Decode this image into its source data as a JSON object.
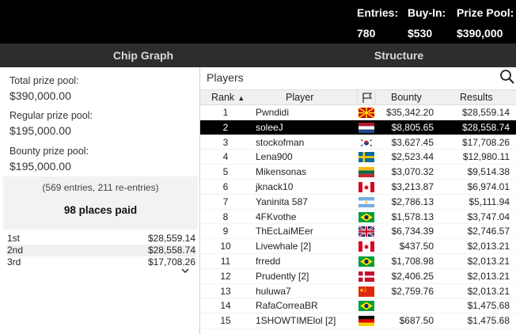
{
  "header": {
    "entries_label": "Entries:",
    "entries_value": "780",
    "buyin_label": "Buy-In:",
    "buyin_value": "$530",
    "prize_label": "Prize Pool:",
    "prize_value": "$390,000"
  },
  "tabs": {
    "chip_graph": "Chip Graph",
    "structure": "Structure"
  },
  "left_panel": {
    "total_label": "Total prize pool:",
    "total_value": "$390,000.00",
    "regular_label": "Regular prize pool:",
    "regular_value": "$195,000.00",
    "bounty_label": "Bounty prize pool:",
    "bounty_value": "$195,000.00",
    "entries_note": "(569 entries, 211 re-entries)",
    "places_paid": "98 places paid",
    "payouts": [
      {
        "place": "1st",
        "amount": "$28,559.14"
      },
      {
        "place": "2nd",
        "amount": "$28,558.74"
      },
      {
        "place": "3rd",
        "amount": "$17,708.26"
      }
    ]
  },
  "players_panel": {
    "title": "Players",
    "columns": {
      "rank": "Rank",
      "player": "Player",
      "bounty": "Bounty",
      "results": "Results"
    },
    "rows": [
      {
        "rank": "1",
        "player": "Pwndidi",
        "flag": "north-macedonia-flag",
        "bounty": "$35,342.20",
        "result": "$28,559.14"
      },
      {
        "rank": "2",
        "player": "soleeJ",
        "flag": "netherlands-flag",
        "bounty": "$8,805.65",
        "result": "$28,558.74"
      },
      {
        "rank": "3",
        "player": "stockofman",
        "flag": "south-korea-flag",
        "bounty": "$3,627.45",
        "result": "$17,708.26"
      },
      {
        "rank": "4",
        "player": "Lena900",
        "flag": "sweden-flag",
        "bounty": "$2,523.44",
        "result": "$12,980.11"
      },
      {
        "rank": "5",
        "player": "Mikensonas",
        "flag": "lithuania-flag",
        "bounty": "$3,070.32",
        "result": "$9,514.38"
      },
      {
        "rank": "6",
        "player": "jknack10",
        "flag": "canada-flag",
        "bounty": "$3,213.87",
        "result": "$6,974.01"
      },
      {
        "rank": "7",
        "player": "Yaninita 587",
        "flag": "argentina-flag",
        "bounty": "$2,786.13",
        "result": "$5,111.94"
      },
      {
        "rank": "8",
        "player": "4FKvothe",
        "flag": "brazil-flag",
        "bounty": "$1,578.13",
        "result": "$3,747.04"
      },
      {
        "rank": "9",
        "player": "ThEcLaiMEer",
        "flag": "uk-flag",
        "bounty": "$6,734.39",
        "result": "$2,746.57"
      },
      {
        "rank": "10",
        "player": "Livewhale [2]",
        "flag": "canada-flag",
        "bounty": "$437.50",
        "result": "$2,013.21"
      },
      {
        "rank": "11",
        "player": "frredd",
        "flag": "brazil-flag",
        "bounty": "$1,708.98",
        "result": "$2,013.21"
      },
      {
        "rank": "12",
        "player": "Prudently [2]",
        "flag": "denmark-flag",
        "bounty": "$2,406.25",
        "result": "$2,013.21"
      },
      {
        "rank": "13",
        "player": "huluwa7",
        "flag": "china-flag",
        "bounty": "$2,759.76",
        "result": "$2,013.21"
      },
      {
        "rank": "14",
        "player": "RafaCorreaBR",
        "flag": "brazil-flag",
        "bounty": "",
        "result": "$1,475.68"
      },
      {
        "rank": "15",
        "player": "1SHOWTIMElol [2]",
        "flag": "germany-flag",
        "bounty": "$687.50",
        "result": "$1,475.68"
      }
    ],
    "selected_rank": "2"
  },
  "colors": {
    "header_bg": "#000000",
    "tabbar_bg": "#2d2d2d",
    "selected_row_bg": "#000000"
  }
}
